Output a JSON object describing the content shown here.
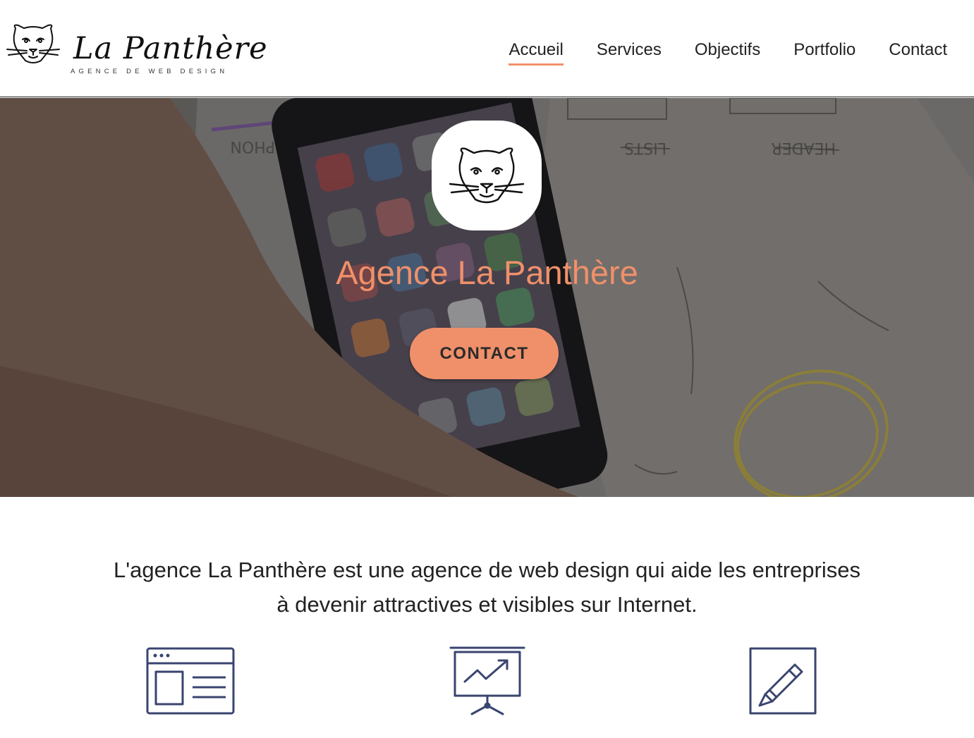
{
  "brand": {
    "title": "La Panthère",
    "subtitle": "AGENCE DE WEB DESIGN",
    "icon": "panther-head-icon"
  },
  "nav": {
    "items": [
      {
        "label": "Accueil",
        "active": true
      },
      {
        "label": "Services",
        "active": false
      },
      {
        "label": "Objectifs",
        "active": false
      },
      {
        "label": "Portfolio",
        "active": false
      },
      {
        "label": "Contact",
        "active": false
      }
    ]
  },
  "hero": {
    "title": "Agence La Panthère",
    "cta_label": "CONTACT",
    "badge_icon": "panther-head-icon"
  },
  "intro": {
    "text": "L'agence La Panthère est une agence de web design qui aide les entreprises à devenir attractives et visibles sur Internet."
  },
  "features": [
    {
      "icon": "web-layout-icon"
    },
    {
      "icon": "presentation-chart-icon"
    },
    {
      "icon": "pencil-edit-icon"
    }
  ],
  "colors": {
    "accent": "#f0906a",
    "icon_stroke": "#3a4470",
    "text": "#222222"
  }
}
